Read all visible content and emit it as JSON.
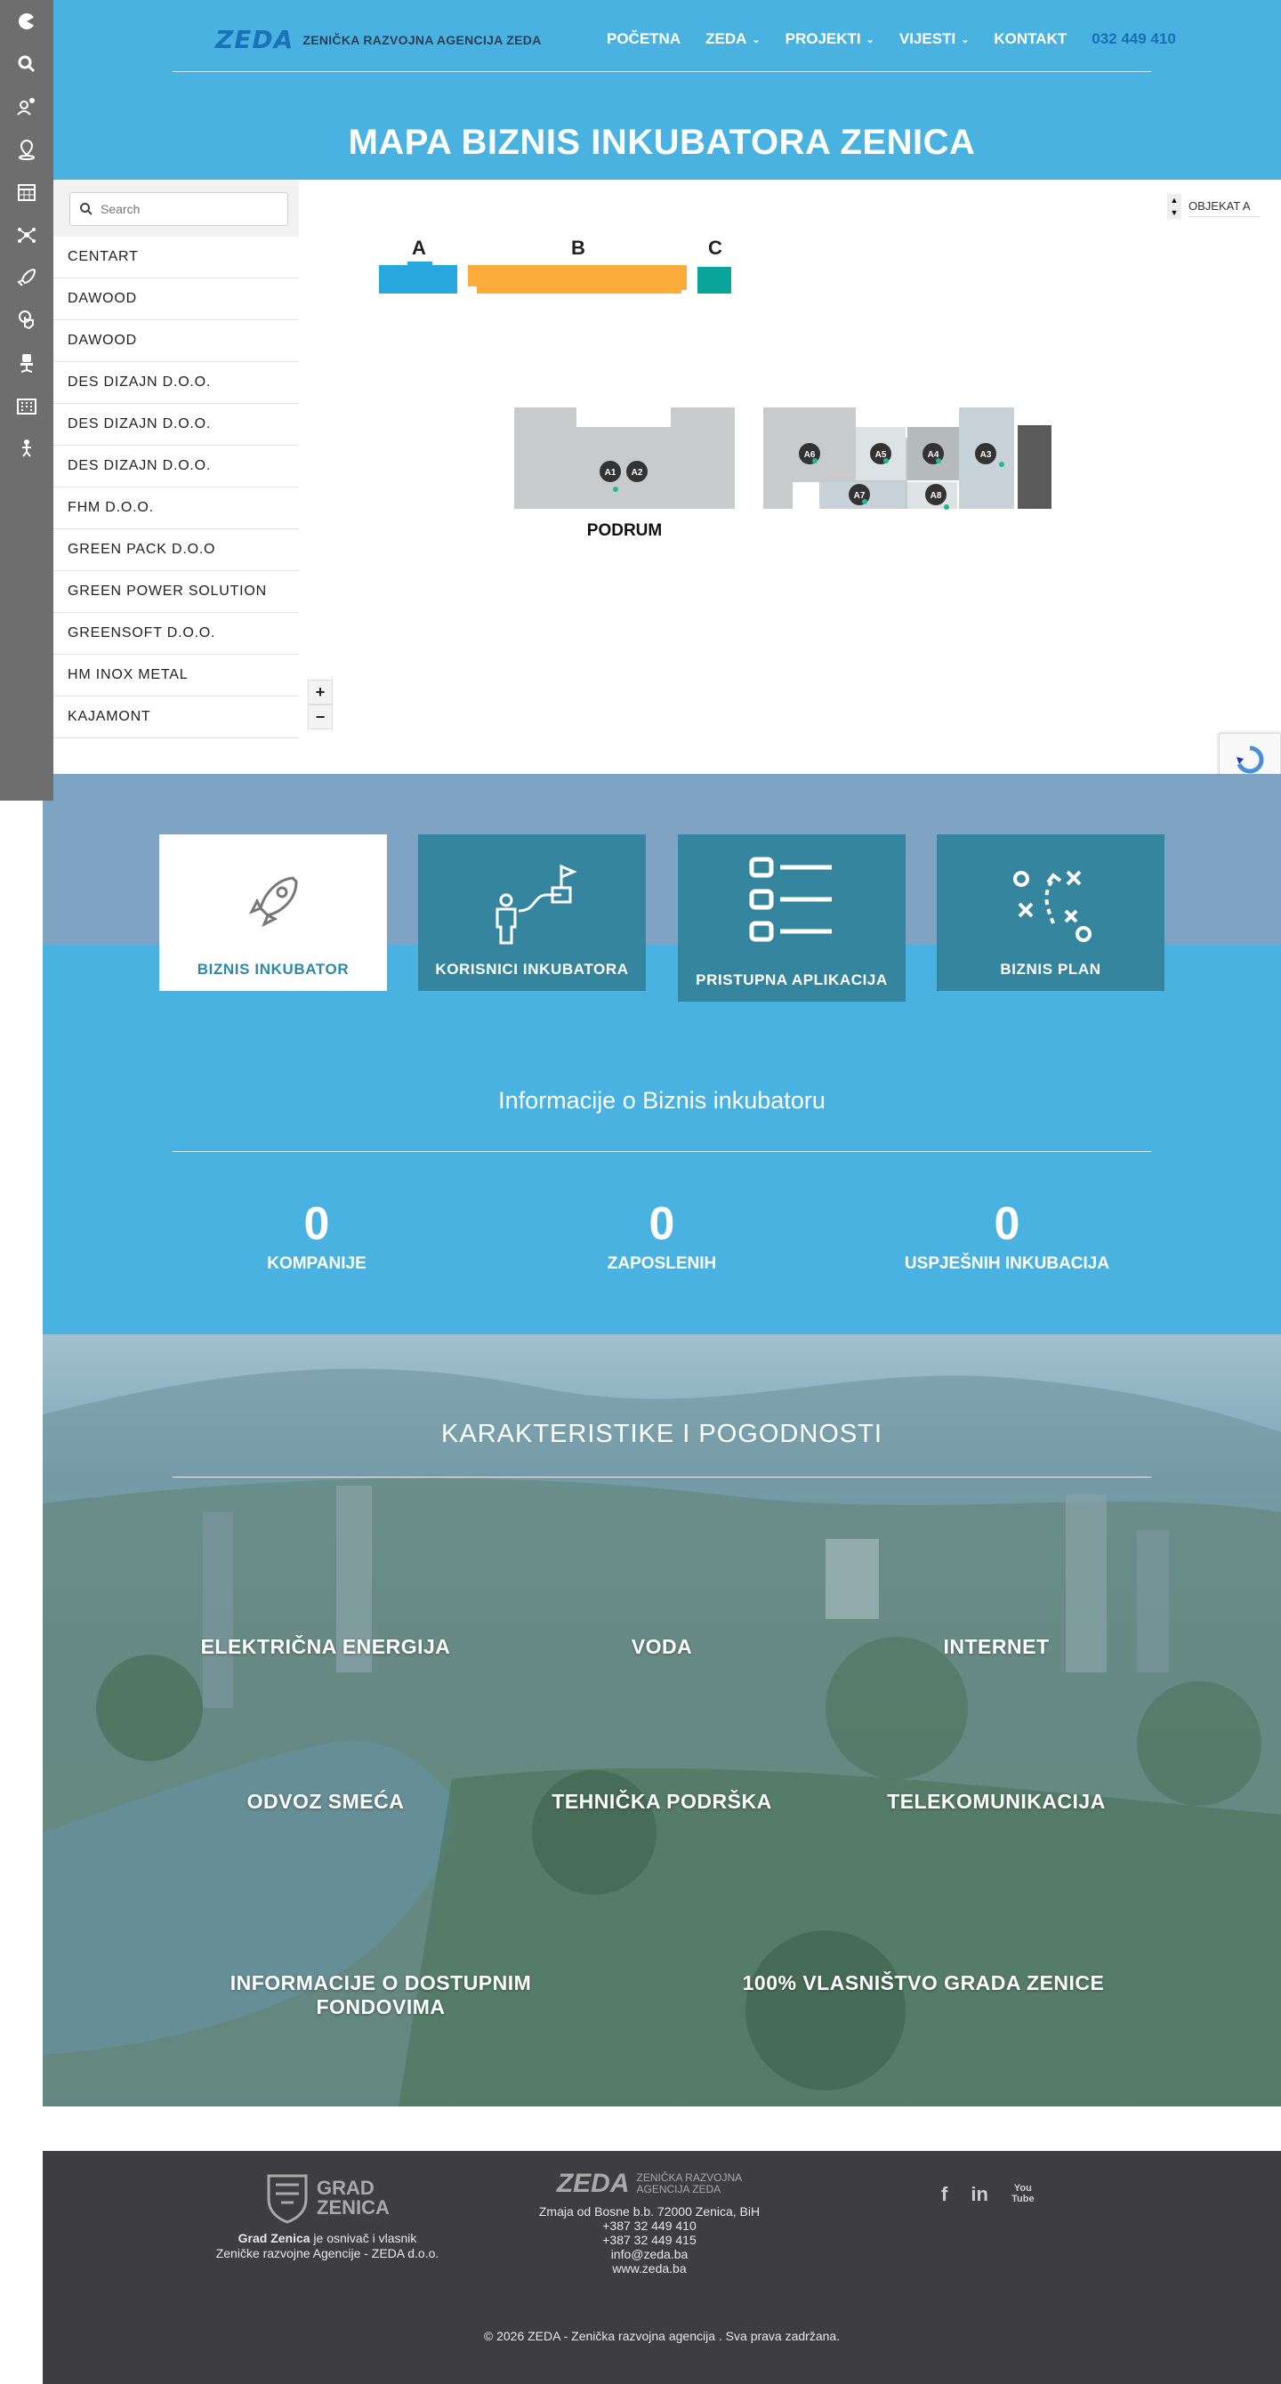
{
  "header": {
    "logo_mark": "ZEDA",
    "logo_text": "ZENIČKA RAZVOJNA AGENCIJA ZEDA",
    "nav": [
      {
        "label": "POČETNA",
        "chev": ""
      },
      {
        "label": "ZEDA",
        "chev": "⌄"
      },
      {
        "label": "PROJEKTI",
        "chev": "⌄"
      },
      {
        "label": "VIJESTI",
        "chev": "⌄"
      },
      {
        "label": "KONTAKT",
        "chev": ""
      }
    ],
    "phone": "032 449 410",
    "page_title": "MAPA BIZNIS INKUBATORA ZENICA"
  },
  "dock": {
    "icons": [
      "pacman-icon",
      "search-icon",
      "settings-user-icon",
      "location-pin-icon",
      "calendar-icon",
      "network-icon",
      "rocket-icon",
      "touch-icon",
      "office-chair-icon",
      "building-icon",
      "presenter-icon"
    ]
  },
  "map": {
    "search_placeholder": "Search",
    "companies": [
      "CENTART",
      "DAWOOD",
      "DAWOOD",
      "DES DIZAJN D.O.O.",
      "DES DIZAJN D.O.O.",
      "DES DIZAJN D.O.O.",
      "FHM D.O.O.",
      "GREEN PACK D.O.O",
      "GREEN POWER SOLUTION",
      "GREENSOFT D.O.O.",
      "HM INOX METAL",
      "KAJAMONT"
    ],
    "zoom_in": "+",
    "zoom_out": "−",
    "object_select": "OBJEKAT A",
    "building_labels": {
      "a": "A",
      "b": "B",
      "c": "C"
    },
    "floor_label": "PODRUM",
    "units": {
      "a1": "A1",
      "a2": "A2",
      "a3": "A3",
      "a4": "A4",
      "a5": "A5",
      "a6": "A6",
      "a7": "A7",
      "a8": "A8"
    },
    "colors": {
      "a": "#29a8df",
      "b": "#fbac3b",
      "c": "#0aa59a",
      "floor": "#c8cacc",
      "unit_badge": "#333333",
      "unit_dot": "#1dbb8e"
    }
  },
  "cards": [
    {
      "label": "BIZNIS INKUBATOR",
      "icon": "rocket-icon",
      "active": true
    },
    {
      "label": "KORISNICI INKUBATORA",
      "icon": "person-flag-icon",
      "active": false
    },
    {
      "label": "PRISTUPNA APLIKACIJA",
      "icon": "checklist-icon",
      "active": false
    },
    {
      "label": "BIZNIS PLAN",
      "icon": "strategy-icon",
      "active": false
    }
  ],
  "info": {
    "title": "Informacije o Biznis inkubatoru",
    "stats": [
      {
        "value": "0",
        "label": "KOMPANIJE"
      },
      {
        "value": "0",
        "label": "ZAPOSLENIH"
      },
      {
        "value": "0",
        "label": "USPJEŠNIH INKUBACIJA"
      }
    ]
  },
  "features": {
    "title": "KARAKTERISTIKE I POGODNOSTI",
    "items": [
      "ELEKTRIČNA ENERGIJA",
      "VODA",
      "INTERNET",
      "ODVOZ SMEĆA",
      "TEHNIČKA PODRŠKA",
      "TELEKOMUNIKACIJA",
      "INFORMACIJE O DOSTUPNIM FONDOVIMA",
      "100% VLASNIŠTVO GRADA ZENICE"
    ]
  },
  "footer": {
    "grad_logo_line1": "GRAD",
    "grad_logo_line2": "ZENICA",
    "grad_strong": "Grad Zenica",
    "grad_text1": " je osnivač i vlasnik",
    "grad_text2": "Zeničke razvojne Agencije - ZEDA d.o.o.",
    "zeda_mark": "ZEDA",
    "zeda_name1": "ZENIČKA RAZVOJNA",
    "zeda_name2": "AGENCIJA ZEDA",
    "address": "Zmaja od Bosne b.b. 72000 Zenica, BiH",
    "phone1": "+387 32 449 410",
    "phone2": "+387 32 449 415",
    "email": "info@zeda.ba",
    "web": "www.zeda.ba",
    "social": [
      "f",
      "in",
      "You Tube"
    ],
    "copyright": "© 2026 ZEDA - Zenička razvojna agencija . Sva prava zadržana."
  }
}
